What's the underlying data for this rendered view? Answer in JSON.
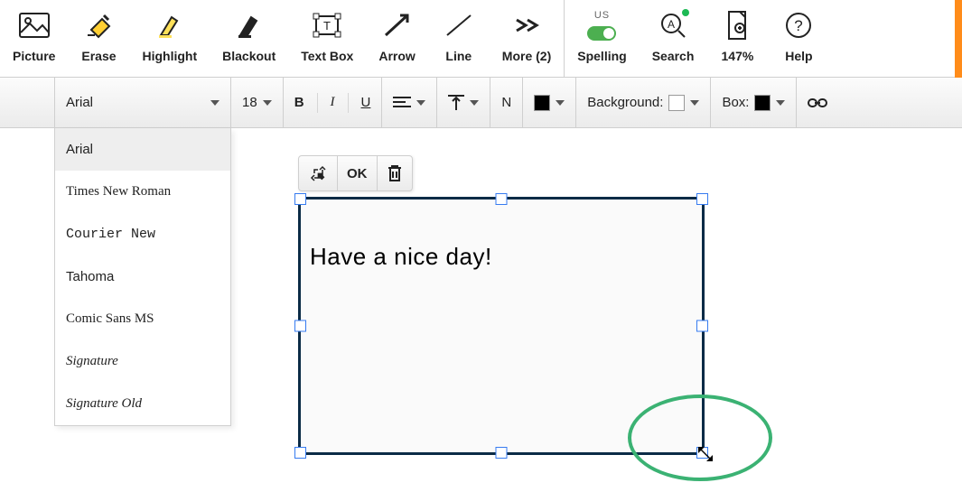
{
  "toolbar_main": {
    "picture": "Picture",
    "erase": "Erase",
    "highlight": "Highlight",
    "blackout": "Blackout",
    "textbox": "Text Box",
    "arrow": "Arrow",
    "line": "Line",
    "more": "More (2)",
    "spelling": "Spelling",
    "spelling_lang": "US",
    "search": "Search",
    "zoom": "147%",
    "help": "Help"
  },
  "format_bar": {
    "font_family": "Arial",
    "font_size": "18",
    "bold_glyph": "B",
    "italic_glyph": "I",
    "underline_glyph": "U",
    "normal_glyph": "N",
    "background_label": "Background:",
    "box_label": "Box:",
    "text_color": "#000000",
    "background_color": "#ffffff",
    "box_color": "#000000"
  },
  "font_dropdown": {
    "options": [
      {
        "label": "Arial",
        "class": ""
      },
      {
        "label": "Times New Roman",
        "class": "f-times"
      },
      {
        "label": "Courier New",
        "class": "f-courier"
      },
      {
        "label": "Tahoma",
        "class": "f-tahoma"
      },
      {
        "label": "Comic Sans MS",
        "class": "f-comic"
      },
      {
        "label": "Signature",
        "class": "f-script"
      },
      {
        "label": "Signature Old",
        "class": "f-script"
      }
    ],
    "selected_index": 0
  },
  "textbox": {
    "content": "Have a nice day!",
    "controls": {
      "ok": "OK"
    }
  },
  "annotation": {
    "shape": "ellipse",
    "color": "#3bb273",
    "target": "se-resize-handle"
  }
}
